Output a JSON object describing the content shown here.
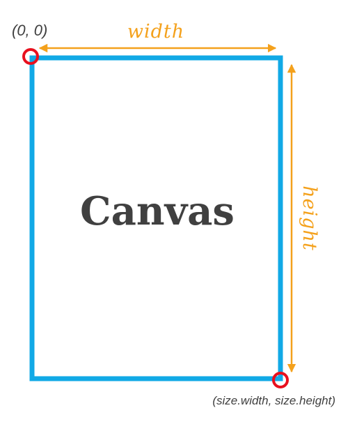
{
  "labels": {
    "origin": "(0, 0)",
    "width": "width",
    "height": "height",
    "canvas": "Canvas",
    "corner": "(size.width, size.height)"
  },
  "colors": {
    "canvas_border": "#11a9e6",
    "dimension_arrows": "#f4a11c",
    "corner_markers": "#e8101e",
    "label_text": "#404040"
  }
}
